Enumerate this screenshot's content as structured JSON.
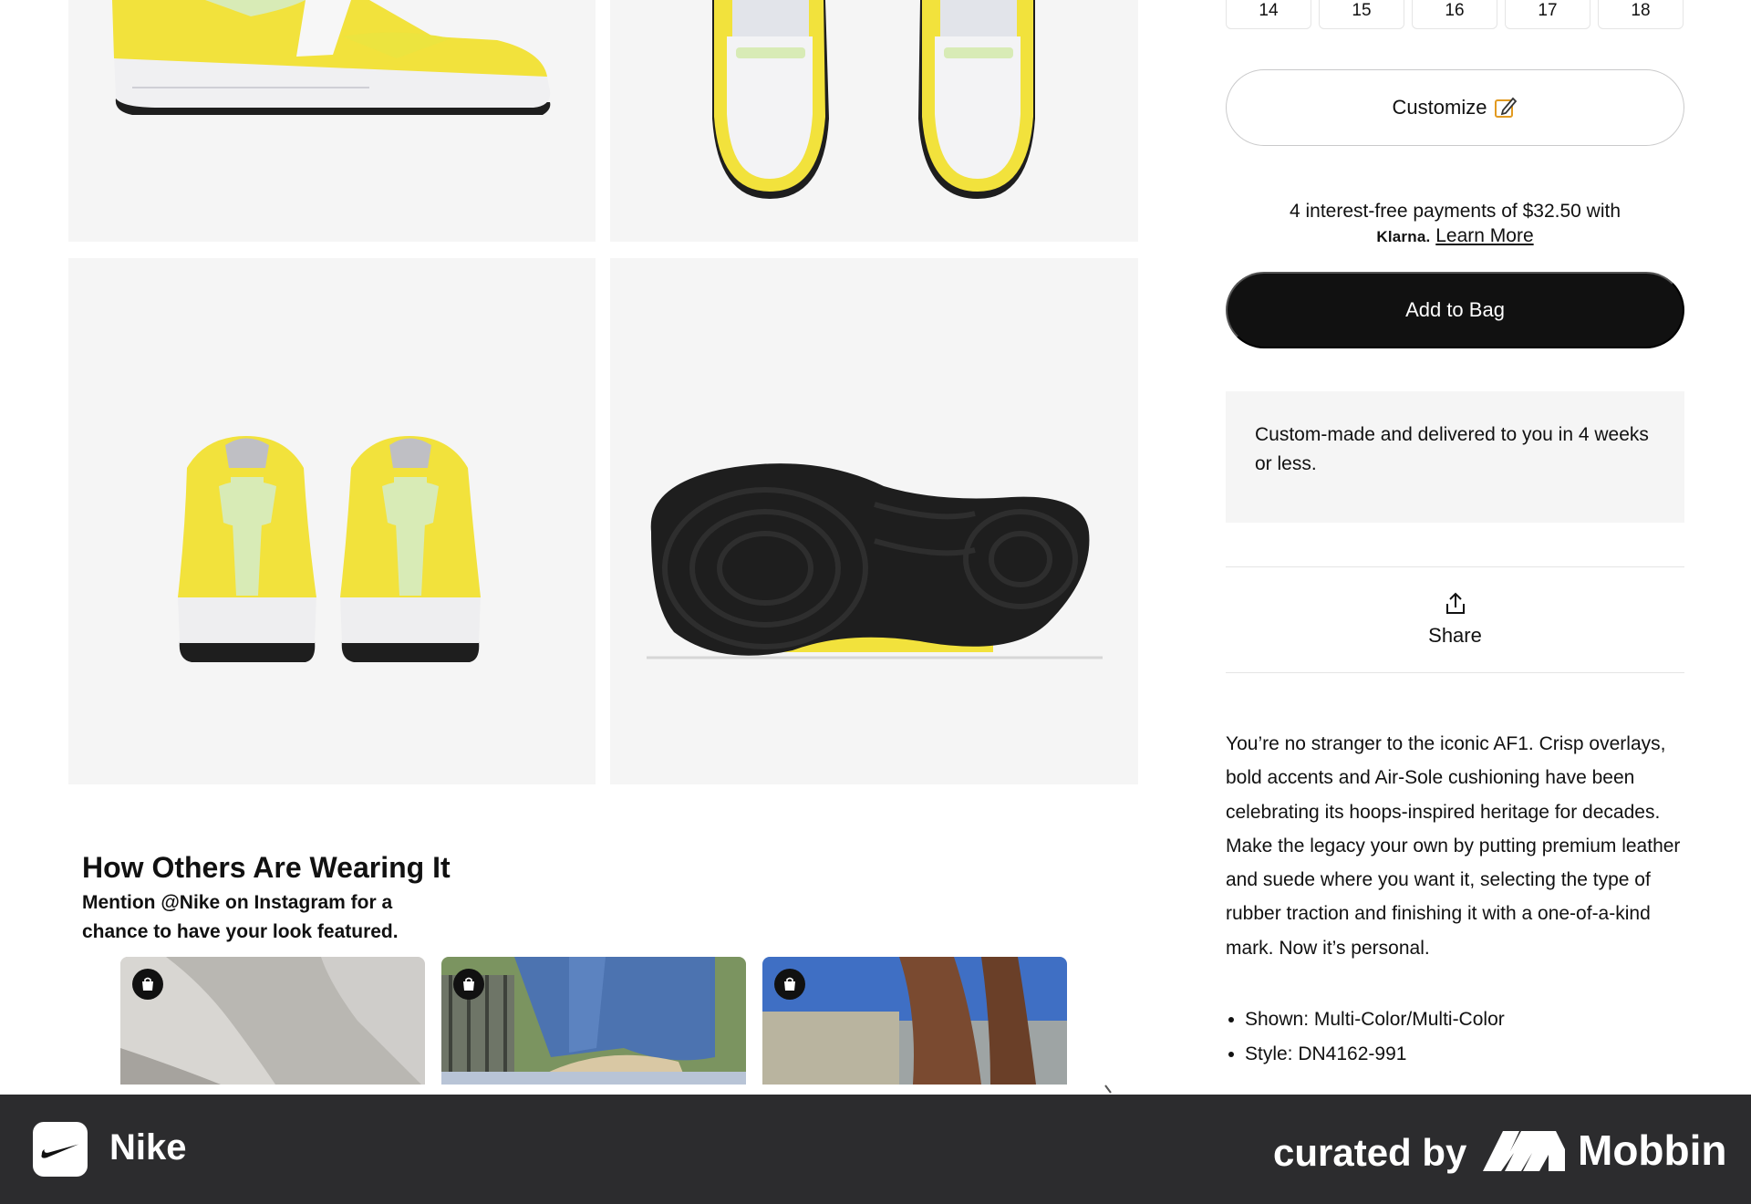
{
  "gallery": {
    "images": [
      {
        "name": "shoe-side-view",
        "alt": "Air Force 1 side view"
      },
      {
        "name": "shoe-top-view",
        "alt": "Air Force 1 top view"
      },
      {
        "name": "shoe-heel-view",
        "alt": "Air Force 1 heel view"
      },
      {
        "name": "shoe-sole-view",
        "alt": "Air Force 1 outsole view"
      }
    ],
    "colors": {
      "upper_yellow": "#f2e23c",
      "accent_mint": "#d8ebb6",
      "white": "#f7f7f7",
      "sole_black": "#1e1e1e"
    }
  },
  "sizes": [
    "14",
    "15",
    "16",
    "17",
    "18"
  ],
  "customize": {
    "label": "Customize",
    "icon": "edit-icon"
  },
  "klarna": {
    "text": "4 interest-free payments of $32.50 with",
    "logo": "Klarna.",
    "link": "Learn More"
  },
  "add_to_bag": {
    "label": "Add to Bag"
  },
  "delivery": {
    "text": "Custom-made and delivered to you in 4 weeks or less."
  },
  "share": {
    "label": "Share",
    "icon": "share-icon"
  },
  "description": "You’re no stranger to the iconic AF1. Crisp overlays, bold accents and Air-Sole cushioning have been celebrating its hoops-inspired heritage for decades. Make the legacy your own by putting premium leather and suede where you want it, selecting the type of rubber traction and finishing it with a one-of-a-kind mark. Now it’s personal.",
  "details": [
    "Shown: Multi-Color/Multi-Color",
    "Style: DN4162-991"
  ],
  "how_others": {
    "title": "How Others Are Wearing It",
    "subtitle": "Mention @Nike on Instagram for a chance to have your look featured.",
    "photos": [
      {
        "name": "ugc-photo-grey-pants",
        "badge": "shopping-bag-icon"
      },
      {
        "name": "ugc-photo-denim",
        "badge": "shopping-bag-icon"
      },
      {
        "name": "ugc-photo-legs",
        "badge": "shopping-bag-icon"
      }
    ]
  },
  "bottom_bar": {
    "app_name": "Nike",
    "curated_by": "curated by",
    "brand": "Mobbin",
    "background": "#2c2c2e"
  }
}
